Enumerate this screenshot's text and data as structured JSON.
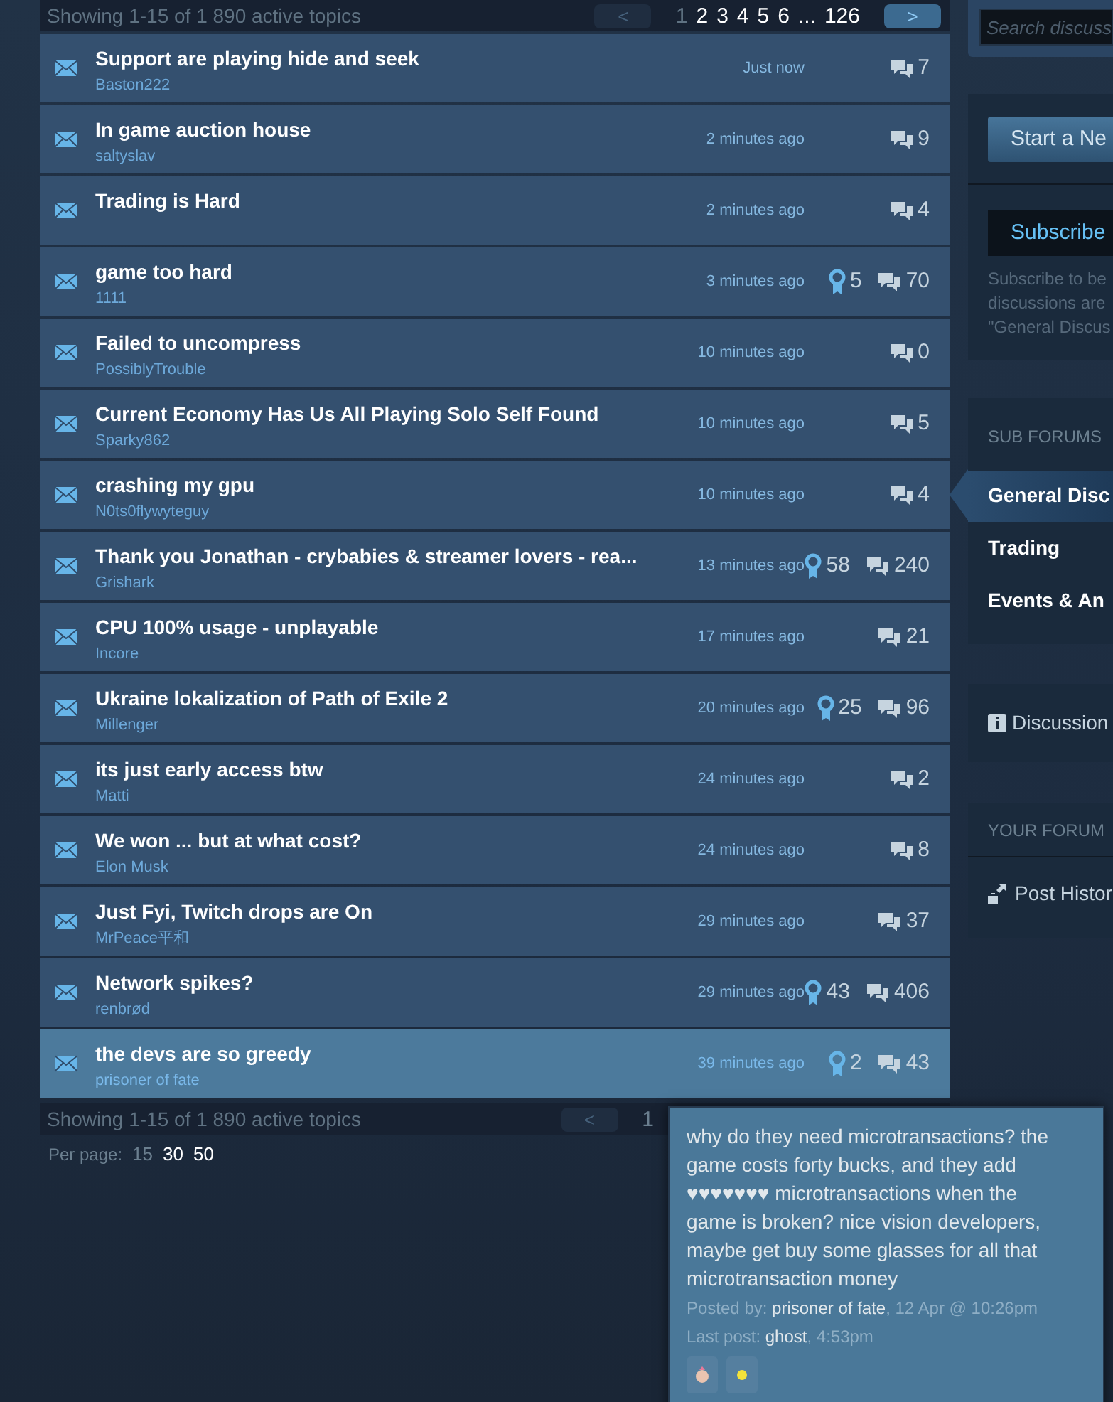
{
  "topics_header": {
    "summary": "Showing 1-15 of 1 890 active topics",
    "prev": "<",
    "next": ">",
    "pages": [
      {
        "label": "1",
        "selected": true
      },
      {
        "label": "2",
        "selected": false
      },
      {
        "label": "3",
        "selected": false
      },
      {
        "label": "4",
        "selected": false
      },
      {
        "label": "5",
        "selected": false
      },
      {
        "label": "6",
        "selected": false
      },
      {
        "label": "...",
        "selected": false
      },
      {
        "label": "126",
        "selected": false
      }
    ]
  },
  "topics": [
    {
      "title": "Support are playing hide and seek",
      "author": "Baston222",
      "time": "Just now",
      "replies": "7",
      "highlighted": false
    },
    {
      "title": "In game auction house",
      "author": "saltyslav",
      "time": "2 minutes ago",
      "replies": "9",
      "highlighted": false
    },
    {
      "title": "Trading is Hard",
      "time": "2 minutes ago",
      "replies": "4",
      "highlighted": false
    },
    {
      "title": "game too hard",
      "author": "1111",
      "time": "3 minutes ago",
      "awards": "5",
      "replies": "70",
      "highlighted": false
    },
    {
      "title": "Failed to uncompress",
      "author": "PossiblyTrouble",
      "time": "10 minutes ago",
      "replies": "0",
      "highlighted": false
    },
    {
      "title": "Current Economy Has Us All Playing Solo Self Found",
      "author": "Sparky862",
      "time": "10 minutes ago",
      "replies": "5",
      "highlighted": false
    },
    {
      "title": "crashing my gpu",
      "author": "N0ts0flywyteguy",
      "time": "10 minutes ago",
      "replies": "4",
      "highlighted": false
    },
    {
      "title": "Thank you Jonathan - crybabies & streamer lovers - rea...",
      "author": "Grishark",
      "time": "13 minutes ago",
      "awards": "58",
      "replies": "240",
      "highlighted": false
    },
    {
      "title": "CPU 100% usage - unplayable",
      "author": "Incore",
      "time": "17 minutes ago",
      "replies": "21",
      "highlighted": false
    },
    {
      "title": "Ukraine lokalization of Path of Exile 2",
      "author": "Millenger",
      "time": "20 minutes ago",
      "awards": "25",
      "replies": "96",
      "highlighted": false
    },
    {
      "title": "its just early access btw",
      "author": "Matti",
      "time": "24 minutes ago",
      "replies": "2",
      "highlighted": false
    },
    {
      "title": "We won ... but at what cost?",
      "author": "Elon Musk",
      "time": "24 minutes ago",
      "replies": "8",
      "highlighted": false
    },
    {
      "title": "Just Fyi, Twitch drops are On",
      "author": "MrPeace平和",
      "time": "29 minutes ago",
      "replies": "37",
      "highlighted": false
    },
    {
      "title": "Network spikes?",
      "author": "renbrød",
      "time": "29 minutes ago",
      "awards": "43",
      "replies": "406",
      "highlighted": false
    },
    {
      "title": "the devs are so greedy",
      "author": "prisoner of fate",
      "time": "39 minutes ago",
      "awards": "2",
      "replies": "43",
      "highlighted": true
    }
  ],
  "topics_footer": {
    "summary": "Showing 1-15 of 1 890 active topics",
    "prev": "<",
    "pages": [
      {
        "label": "1",
        "selected": true
      }
    ],
    "per_page_label": "Per page:",
    "per_page": [
      {
        "label": "15",
        "selected": true
      },
      {
        "label": "30",
        "selected": false
      },
      {
        "label": "50",
        "selected": false
      }
    ]
  },
  "sidebar": {
    "search": {
      "placeholder": "Search discuss"
    },
    "start_button": "Start a Ne",
    "subscribe_button": "Subscribe",
    "subscribe_text": [
      "Subscribe to be",
      "discussions are",
      "\"General Discus"
    ],
    "sub_forums_title": "SUB FORUMS",
    "sub_forums": [
      {
        "label": "General Disc",
        "selected": true
      },
      {
        "label": "Trading",
        "selected": false
      },
      {
        "label": "Events & An",
        "selected": false
      }
    ],
    "discussion_link": "Discussion",
    "your_forum_title": "YOUR FORUM",
    "post_history": "Post Histor"
  },
  "tooltip": {
    "body": "why do they need microtransactions? the game costs forty bucks, and they add ♥♥♥♥♥♥♥ microtransactions when the game is broken? nice vision developers, maybe get buy some glasses for all that microtransaction money",
    "posted_label": "Posted by: ",
    "posted_name": "prisoner of fate",
    "posted_rest": ", 12 Apr @ 10:26pm",
    "last_label": "Last post: ",
    "last_name": "ghost",
    "last_rest": ", 4:53pm"
  }
}
